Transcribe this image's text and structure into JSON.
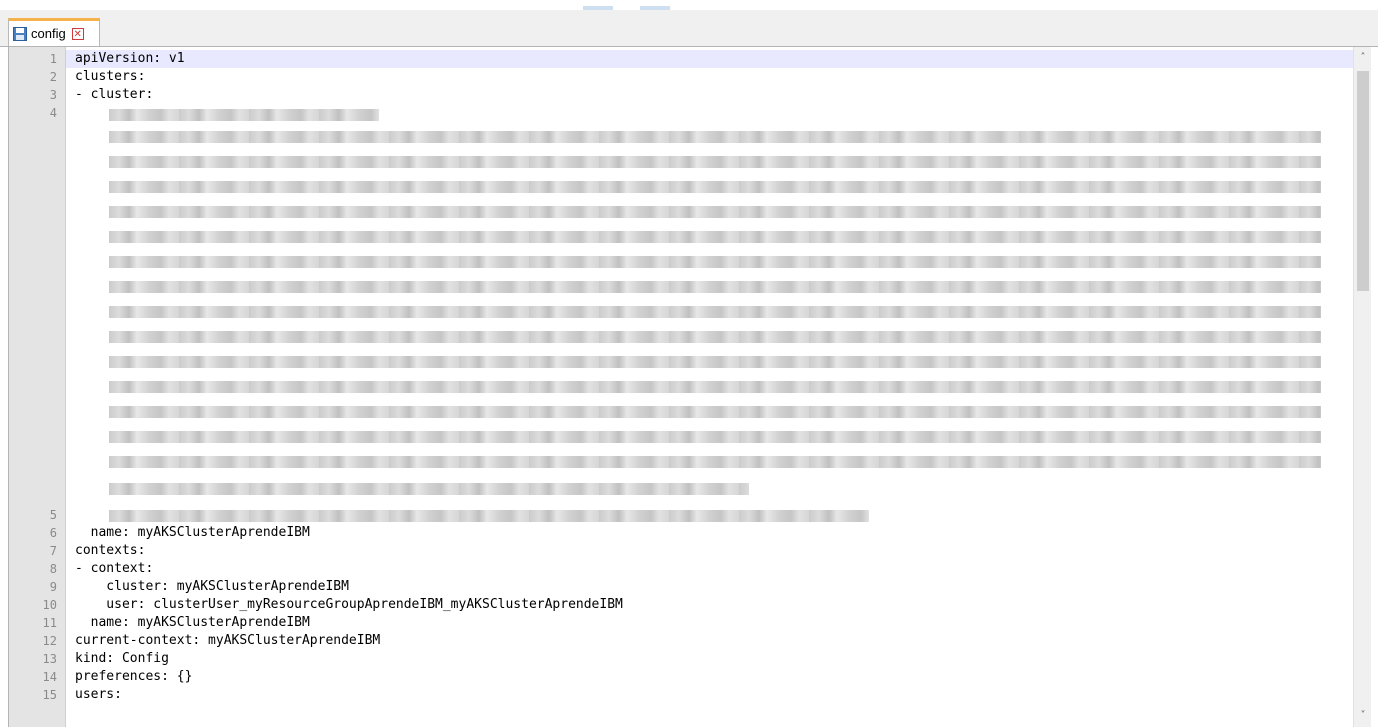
{
  "tab": {
    "title": "config",
    "close_glyph": "✕",
    "icon": "save-icon"
  },
  "line_numbers": [
    "1",
    "2",
    "3",
    "4",
    "5",
    "6",
    "7",
    "8",
    "9",
    "10",
    "11",
    "12",
    "13",
    "14",
    "15"
  ],
  "code": {
    "l1": "apiVersion: v1",
    "l2": "clusters:",
    "l3": "- cluster:",
    "l6": "  name: myAKSClusterAprendeIBM",
    "l7": "contexts:",
    "l8": "- context:",
    "l9": "    cluster: myAKSClusterAprendeIBM",
    "l10": "    user: clusterUser_myResourceGroupAprendeIBM_myAKSClusterAprendeIBM",
    "l11": "  name: myAKSClusterAprendeIBM",
    "l12": "current-context: myAKSClusterAprendeIBM",
    "l13": "kind: Config",
    "l14": "preferences: {}",
    "l15": "users:"
  },
  "scrollbar": {
    "up_glyph": "˄",
    "down_glyph": "˅"
  },
  "colors": {
    "tab_accent": "#f7b14a",
    "gutter": "#e4e4e4",
    "current_line": "#e8e8ff"
  }
}
